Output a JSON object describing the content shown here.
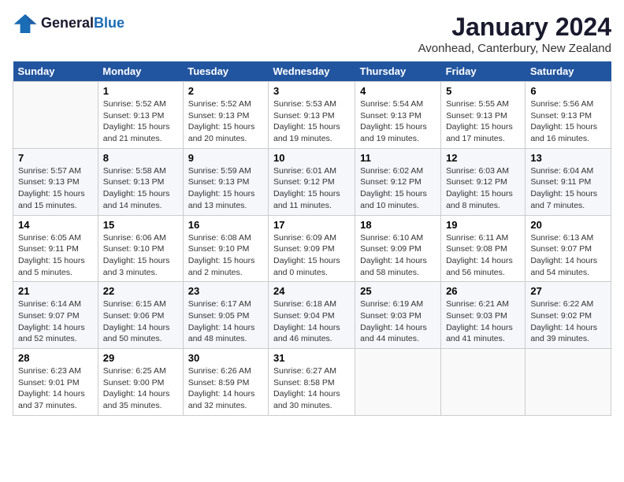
{
  "header": {
    "logo_line1": "General",
    "logo_line2": "Blue",
    "month_title": "January 2024",
    "location": "Avonhead, Canterbury, New Zealand"
  },
  "weekdays": [
    "Sunday",
    "Monday",
    "Tuesday",
    "Wednesday",
    "Thursday",
    "Friday",
    "Saturday"
  ],
  "weeks": [
    [
      {
        "num": "",
        "sunrise": "",
        "sunset": "",
        "daylight": ""
      },
      {
        "num": "1",
        "sunrise": "Sunrise: 5:52 AM",
        "sunset": "Sunset: 9:13 PM",
        "daylight": "Daylight: 15 hours and 21 minutes."
      },
      {
        "num": "2",
        "sunrise": "Sunrise: 5:52 AM",
        "sunset": "Sunset: 9:13 PM",
        "daylight": "Daylight: 15 hours and 20 minutes."
      },
      {
        "num": "3",
        "sunrise": "Sunrise: 5:53 AM",
        "sunset": "Sunset: 9:13 PM",
        "daylight": "Daylight: 15 hours and 19 minutes."
      },
      {
        "num": "4",
        "sunrise": "Sunrise: 5:54 AM",
        "sunset": "Sunset: 9:13 PM",
        "daylight": "Daylight: 15 hours and 19 minutes."
      },
      {
        "num": "5",
        "sunrise": "Sunrise: 5:55 AM",
        "sunset": "Sunset: 9:13 PM",
        "daylight": "Daylight: 15 hours and 17 minutes."
      },
      {
        "num": "6",
        "sunrise": "Sunrise: 5:56 AM",
        "sunset": "Sunset: 9:13 PM",
        "daylight": "Daylight: 15 hours and 16 minutes."
      }
    ],
    [
      {
        "num": "7",
        "sunrise": "Sunrise: 5:57 AM",
        "sunset": "Sunset: 9:13 PM",
        "daylight": "Daylight: 15 hours and 15 minutes."
      },
      {
        "num": "8",
        "sunrise": "Sunrise: 5:58 AM",
        "sunset": "Sunset: 9:13 PM",
        "daylight": "Daylight: 15 hours and 14 minutes."
      },
      {
        "num": "9",
        "sunrise": "Sunrise: 5:59 AM",
        "sunset": "Sunset: 9:13 PM",
        "daylight": "Daylight: 15 hours and 13 minutes."
      },
      {
        "num": "10",
        "sunrise": "Sunrise: 6:01 AM",
        "sunset": "Sunset: 9:12 PM",
        "daylight": "Daylight: 15 hours and 11 minutes."
      },
      {
        "num": "11",
        "sunrise": "Sunrise: 6:02 AM",
        "sunset": "Sunset: 9:12 PM",
        "daylight": "Daylight: 15 hours and 10 minutes."
      },
      {
        "num": "12",
        "sunrise": "Sunrise: 6:03 AM",
        "sunset": "Sunset: 9:12 PM",
        "daylight": "Daylight: 15 hours and 8 minutes."
      },
      {
        "num": "13",
        "sunrise": "Sunrise: 6:04 AM",
        "sunset": "Sunset: 9:11 PM",
        "daylight": "Daylight: 15 hours and 7 minutes."
      }
    ],
    [
      {
        "num": "14",
        "sunrise": "Sunrise: 6:05 AM",
        "sunset": "Sunset: 9:11 PM",
        "daylight": "Daylight: 15 hours and 5 minutes."
      },
      {
        "num": "15",
        "sunrise": "Sunrise: 6:06 AM",
        "sunset": "Sunset: 9:10 PM",
        "daylight": "Daylight: 15 hours and 3 minutes."
      },
      {
        "num": "16",
        "sunrise": "Sunrise: 6:08 AM",
        "sunset": "Sunset: 9:10 PM",
        "daylight": "Daylight: 15 hours and 2 minutes."
      },
      {
        "num": "17",
        "sunrise": "Sunrise: 6:09 AM",
        "sunset": "Sunset: 9:09 PM",
        "daylight": "Daylight: 15 hours and 0 minutes."
      },
      {
        "num": "18",
        "sunrise": "Sunrise: 6:10 AM",
        "sunset": "Sunset: 9:09 PM",
        "daylight": "Daylight: 14 hours and 58 minutes."
      },
      {
        "num": "19",
        "sunrise": "Sunrise: 6:11 AM",
        "sunset": "Sunset: 9:08 PM",
        "daylight": "Daylight: 14 hours and 56 minutes."
      },
      {
        "num": "20",
        "sunrise": "Sunrise: 6:13 AM",
        "sunset": "Sunset: 9:07 PM",
        "daylight": "Daylight: 14 hours and 54 minutes."
      }
    ],
    [
      {
        "num": "21",
        "sunrise": "Sunrise: 6:14 AM",
        "sunset": "Sunset: 9:07 PM",
        "daylight": "Daylight: 14 hours and 52 minutes."
      },
      {
        "num": "22",
        "sunrise": "Sunrise: 6:15 AM",
        "sunset": "Sunset: 9:06 PM",
        "daylight": "Daylight: 14 hours and 50 minutes."
      },
      {
        "num": "23",
        "sunrise": "Sunrise: 6:17 AM",
        "sunset": "Sunset: 9:05 PM",
        "daylight": "Daylight: 14 hours and 48 minutes."
      },
      {
        "num": "24",
        "sunrise": "Sunrise: 6:18 AM",
        "sunset": "Sunset: 9:04 PM",
        "daylight": "Daylight: 14 hours and 46 minutes."
      },
      {
        "num": "25",
        "sunrise": "Sunrise: 6:19 AM",
        "sunset": "Sunset: 9:03 PM",
        "daylight": "Daylight: 14 hours and 44 minutes."
      },
      {
        "num": "26",
        "sunrise": "Sunrise: 6:21 AM",
        "sunset": "Sunset: 9:03 PM",
        "daylight": "Daylight: 14 hours and 41 minutes."
      },
      {
        "num": "27",
        "sunrise": "Sunrise: 6:22 AM",
        "sunset": "Sunset: 9:02 PM",
        "daylight": "Daylight: 14 hours and 39 minutes."
      }
    ],
    [
      {
        "num": "28",
        "sunrise": "Sunrise: 6:23 AM",
        "sunset": "Sunset: 9:01 PM",
        "daylight": "Daylight: 14 hours and 37 minutes."
      },
      {
        "num": "29",
        "sunrise": "Sunrise: 6:25 AM",
        "sunset": "Sunset: 9:00 PM",
        "daylight": "Daylight: 14 hours and 35 minutes."
      },
      {
        "num": "30",
        "sunrise": "Sunrise: 6:26 AM",
        "sunset": "Sunset: 8:59 PM",
        "daylight": "Daylight: 14 hours and 32 minutes."
      },
      {
        "num": "31",
        "sunrise": "Sunrise: 6:27 AM",
        "sunset": "Sunset: 8:58 PM",
        "daylight": "Daylight: 14 hours and 30 minutes."
      },
      {
        "num": "",
        "sunrise": "",
        "sunset": "",
        "daylight": ""
      },
      {
        "num": "",
        "sunrise": "",
        "sunset": "",
        "daylight": ""
      },
      {
        "num": "",
        "sunrise": "",
        "sunset": "",
        "daylight": ""
      }
    ]
  ]
}
